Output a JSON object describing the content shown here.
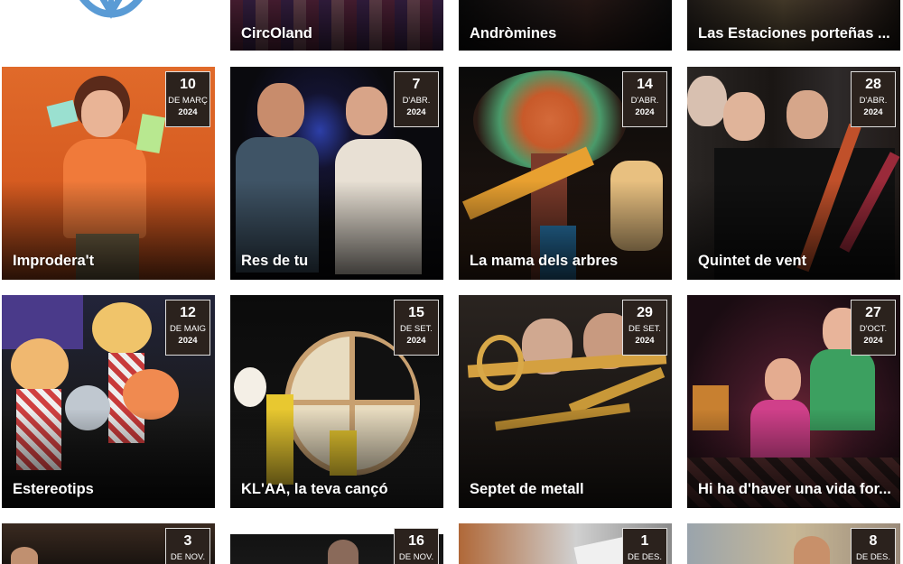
{
  "top_row": {
    "items": [
      {
        "title": "CircOland"
      },
      {
        "title": "Andròmines"
      },
      {
        "title": "Las Estaciones porteñas ..."
      }
    ]
  },
  "events": [
    {
      "title": "Improdera't",
      "day": "10",
      "month": "DE MARÇ",
      "year": "2024"
    },
    {
      "title": "Res de tu",
      "day": "7",
      "month": "D'ABR.",
      "year": "2024"
    },
    {
      "title": "La mama dels arbres",
      "day": "14",
      "month": "D'ABR.",
      "year": "2024"
    },
    {
      "title": "Quintet de vent",
      "day": "28",
      "month": "D'ABR.",
      "year": "2024"
    },
    {
      "title": "Estereotips",
      "day": "12",
      "month": "DE MAIG",
      "year": "2024"
    },
    {
      "title": "KL'AA, la teva cançó",
      "day": "15",
      "month": "DE SET.",
      "year": "2024"
    },
    {
      "title": "Septet de metall",
      "day": "29",
      "month": "DE SET.",
      "year": "2024"
    },
    {
      "title": "Hi ha d'haver una vida for...",
      "day": "27",
      "month": "D'OCT.",
      "year": "2024"
    }
  ],
  "bottom_row": [
    {
      "day": "3",
      "month": "DE NOV."
    },
    {
      "day": "16",
      "month": "DE NOV."
    },
    {
      "day": "1",
      "month": "DE DES."
    },
    {
      "day": "8",
      "month": "DE DES."
    }
  ],
  "colors": {
    "date_badge_bg": "#2b221d",
    "title_text": "#ffffff",
    "logo_blue": "#5a9bd5"
  }
}
